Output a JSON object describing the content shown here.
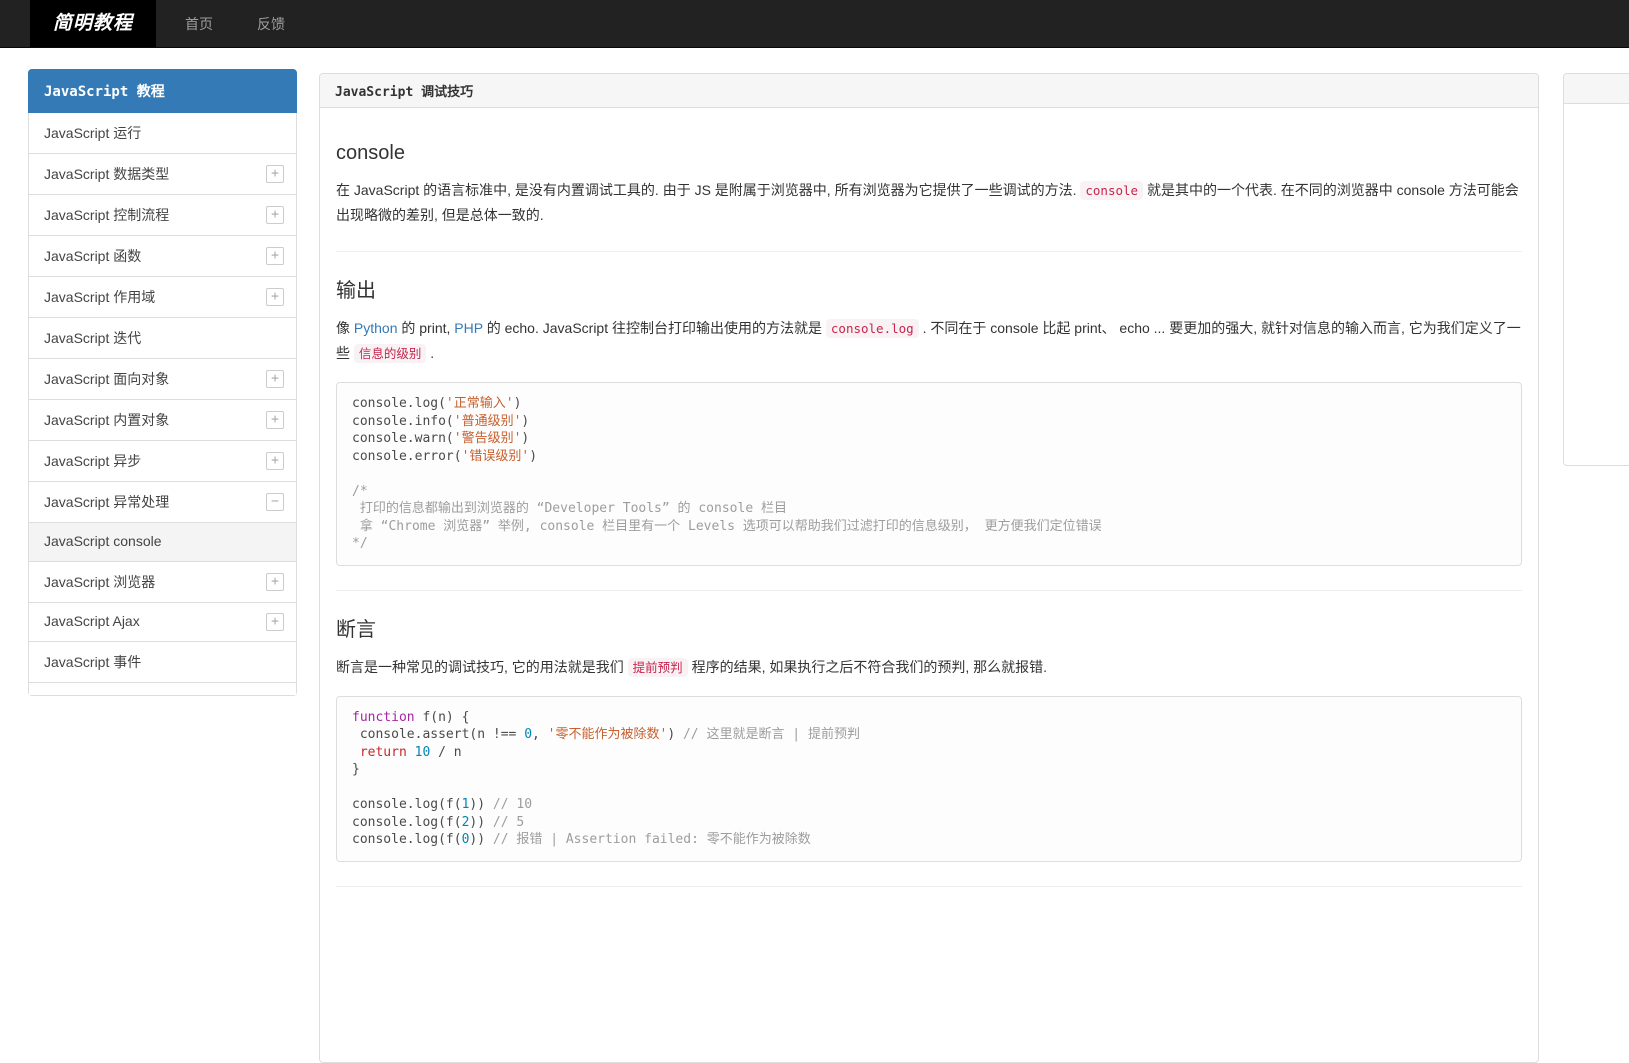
{
  "navbar": {
    "brand": "简明教程",
    "links": [
      {
        "label": "首页"
      },
      {
        "label": "反馈"
      }
    ]
  },
  "sidebar": {
    "header": "JavaScript 教程",
    "items": [
      {
        "label": "JavaScript 运行"
      },
      {
        "label": "JavaScript 数据类型",
        "icon": "plus"
      },
      {
        "label": "JavaScript 控制流程",
        "icon": "plus"
      },
      {
        "label": "JavaScript 函数",
        "icon": "plus"
      },
      {
        "label": "JavaScript 作用域",
        "icon": "plus"
      },
      {
        "label": "JavaScript 迭代"
      },
      {
        "label": "JavaScript 面向对象",
        "icon": "plus"
      },
      {
        "label": "JavaScript 内置对象",
        "icon": "plus"
      },
      {
        "label": "JavaScript 异步",
        "icon": "plus"
      },
      {
        "label": "JavaScript 异常处理",
        "icon": "minus"
      },
      {
        "label": "JavaScript console",
        "active": true
      },
      {
        "label": "JavaScript 浏览器",
        "icon": "plus"
      },
      {
        "label": "JavaScript Ajax",
        "icon": "plus"
      },
      {
        "label": "JavaScript 事件"
      },
      {
        "partial": true
      }
    ]
  },
  "main": {
    "title": "JavaScript 调试技巧",
    "sections": [
      {
        "heading": "console",
        "paragraphs": [
          [
            {
              "t": "在 JavaScript 的语言标准中, 是没有内置调试工具的. 由于 JS 是附属于浏览器中, 所有浏览器为它提供了一些调试的方法. "
            },
            {
              "t": "console",
              "s": "code"
            },
            {
              "t": " 就是其中的一个代表. 在不同的浏览器中 console 方法可能会出现略微的差别, 但是总体一致的."
            }
          ]
        ],
        "divider_after": true
      },
      {
        "heading": "输出",
        "paragraphs": [
          [
            {
              "t": "像 "
            },
            {
              "t": "Python",
              "s": "link"
            },
            {
              "t": " 的 print, "
            },
            {
              "t": "PHP",
              "s": "link"
            },
            {
              "t": " 的 echo. JavaScript 往控制台打印输出使用的方法就是 "
            },
            {
              "t": "console.log",
              "s": "code"
            },
            {
              "t": " . 不同在于 console 比起 print、 echo ... 要更加的强大, 就针对信息的输入而言, 它为我们定义了一些 "
            },
            {
              "t": "信息的级别",
              "s": "code"
            },
            {
              "t": " ."
            }
          ]
        ],
        "code": {
          "lines": [
            [
              {
                "t": "console.log("
              },
              {
                "t": "'正常输入'",
                "s": "str"
              },
              {
                "t": ")"
              }
            ],
            [
              {
                "t": "console.info("
              },
              {
                "t": "'普通级别'",
                "s": "str"
              },
              {
                "t": ")"
              }
            ],
            [
              {
                "t": "console.warn("
              },
              {
                "t": "'警告级别'",
                "s": "str"
              },
              {
                "t": ")"
              }
            ],
            [
              {
                "t": "console.error("
              },
              {
                "t": "'错误级别'",
                "s": "str"
              },
              {
                "t": ")"
              }
            ],
            [],
            [
              {
                "t": "/*",
                "s": "com"
              }
            ],
            [
              {
                "t": " 打印的信息都输出到浏览器的 “Developer Tools” 的 console 栏目",
                "s": "com"
              }
            ],
            [
              {
                "t": " 拿 “Chrome 浏览器” 举例, console 栏目里有一个 Levels 选项可以帮助我们过滤打印的信息级别， 更方便我们定位错误",
                "s": "com"
              }
            ],
            [
              {
                "t": "*/",
                "s": "com"
              }
            ]
          ]
        },
        "divider_after": true
      },
      {
        "heading": "断言",
        "paragraphs": [
          [
            {
              "t": "断言是一种常见的调试技巧, 它的用法就是我们 "
            },
            {
              "t": "提前预判",
              "s": "code"
            },
            {
              "t": " 程序的结果, 如果执行之后不符合我们的预判, 那么就报错."
            }
          ]
        ],
        "code": {
          "lines": [
            [
              {
                "t": "function",
                "s": "kw"
              },
              {
                "t": " f(n) {"
              }
            ],
            [
              {
                "t": " console.assert(n !== "
              },
              {
                "t": "0",
                "s": "num"
              },
              {
                "t": ", "
              },
              {
                "t": "'零不能作为被除数'",
                "s": "str"
              },
              {
                "t": ") "
              },
              {
                "t": "// 这里就是断言 | 提前预判",
                "s": "com"
              }
            ],
            [
              {
                "t": " "
              },
              {
                "t": "return",
                "s": "kw2"
              },
              {
                "t": " "
              },
              {
                "t": "10",
                "s": "num"
              },
              {
                "t": " / n"
              }
            ],
            [
              {
                "t": "}"
              }
            ],
            [],
            [
              {
                "t": "console.log(f("
              },
              {
                "t": "1",
                "s": "num"
              },
              {
                "t": ")) "
              },
              {
                "t": "// 10",
                "s": "com"
              }
            ],
            [
              {
                "t": "console.log(f("
              },
              {
                "t": "2",
                "s": "num"
              },
              {
                "t": ")) "
              },
              {
                "t": "// 5",
                "s": "com"
              }
            ],
            [
              {
                "t": "console.log(f("
              },
              {
                "t": "0",
                "s": "num"
              },
              {
                "t": ")) "
              },
              {
                "t": "// 报错 | Assertion failed: 零不能作为被除数",
                "s": "com"
              }
            ]
          ]
        },
        "divider_after": true
      }
    ]
  },
  "colors": {
    "accent": "#337ab7",
    "navbar_bg": "#222222",
    "brand_bg": "#000000",
    "sidebar_header_bg": "#337ab7",
    "panel_heading_bg": "#f6f6f6",
    "inline_code_fg": "#c7254e",
    "inline_code_bg": "#f9f2f4",
    "code_string": "#c7602f",
    "code_comment": "#9d9d9c",
    "code_keyword": "#a626a4",
    "code_keyword_return": "#c82829",
    "code_number": "#0086b3"
  }
}
